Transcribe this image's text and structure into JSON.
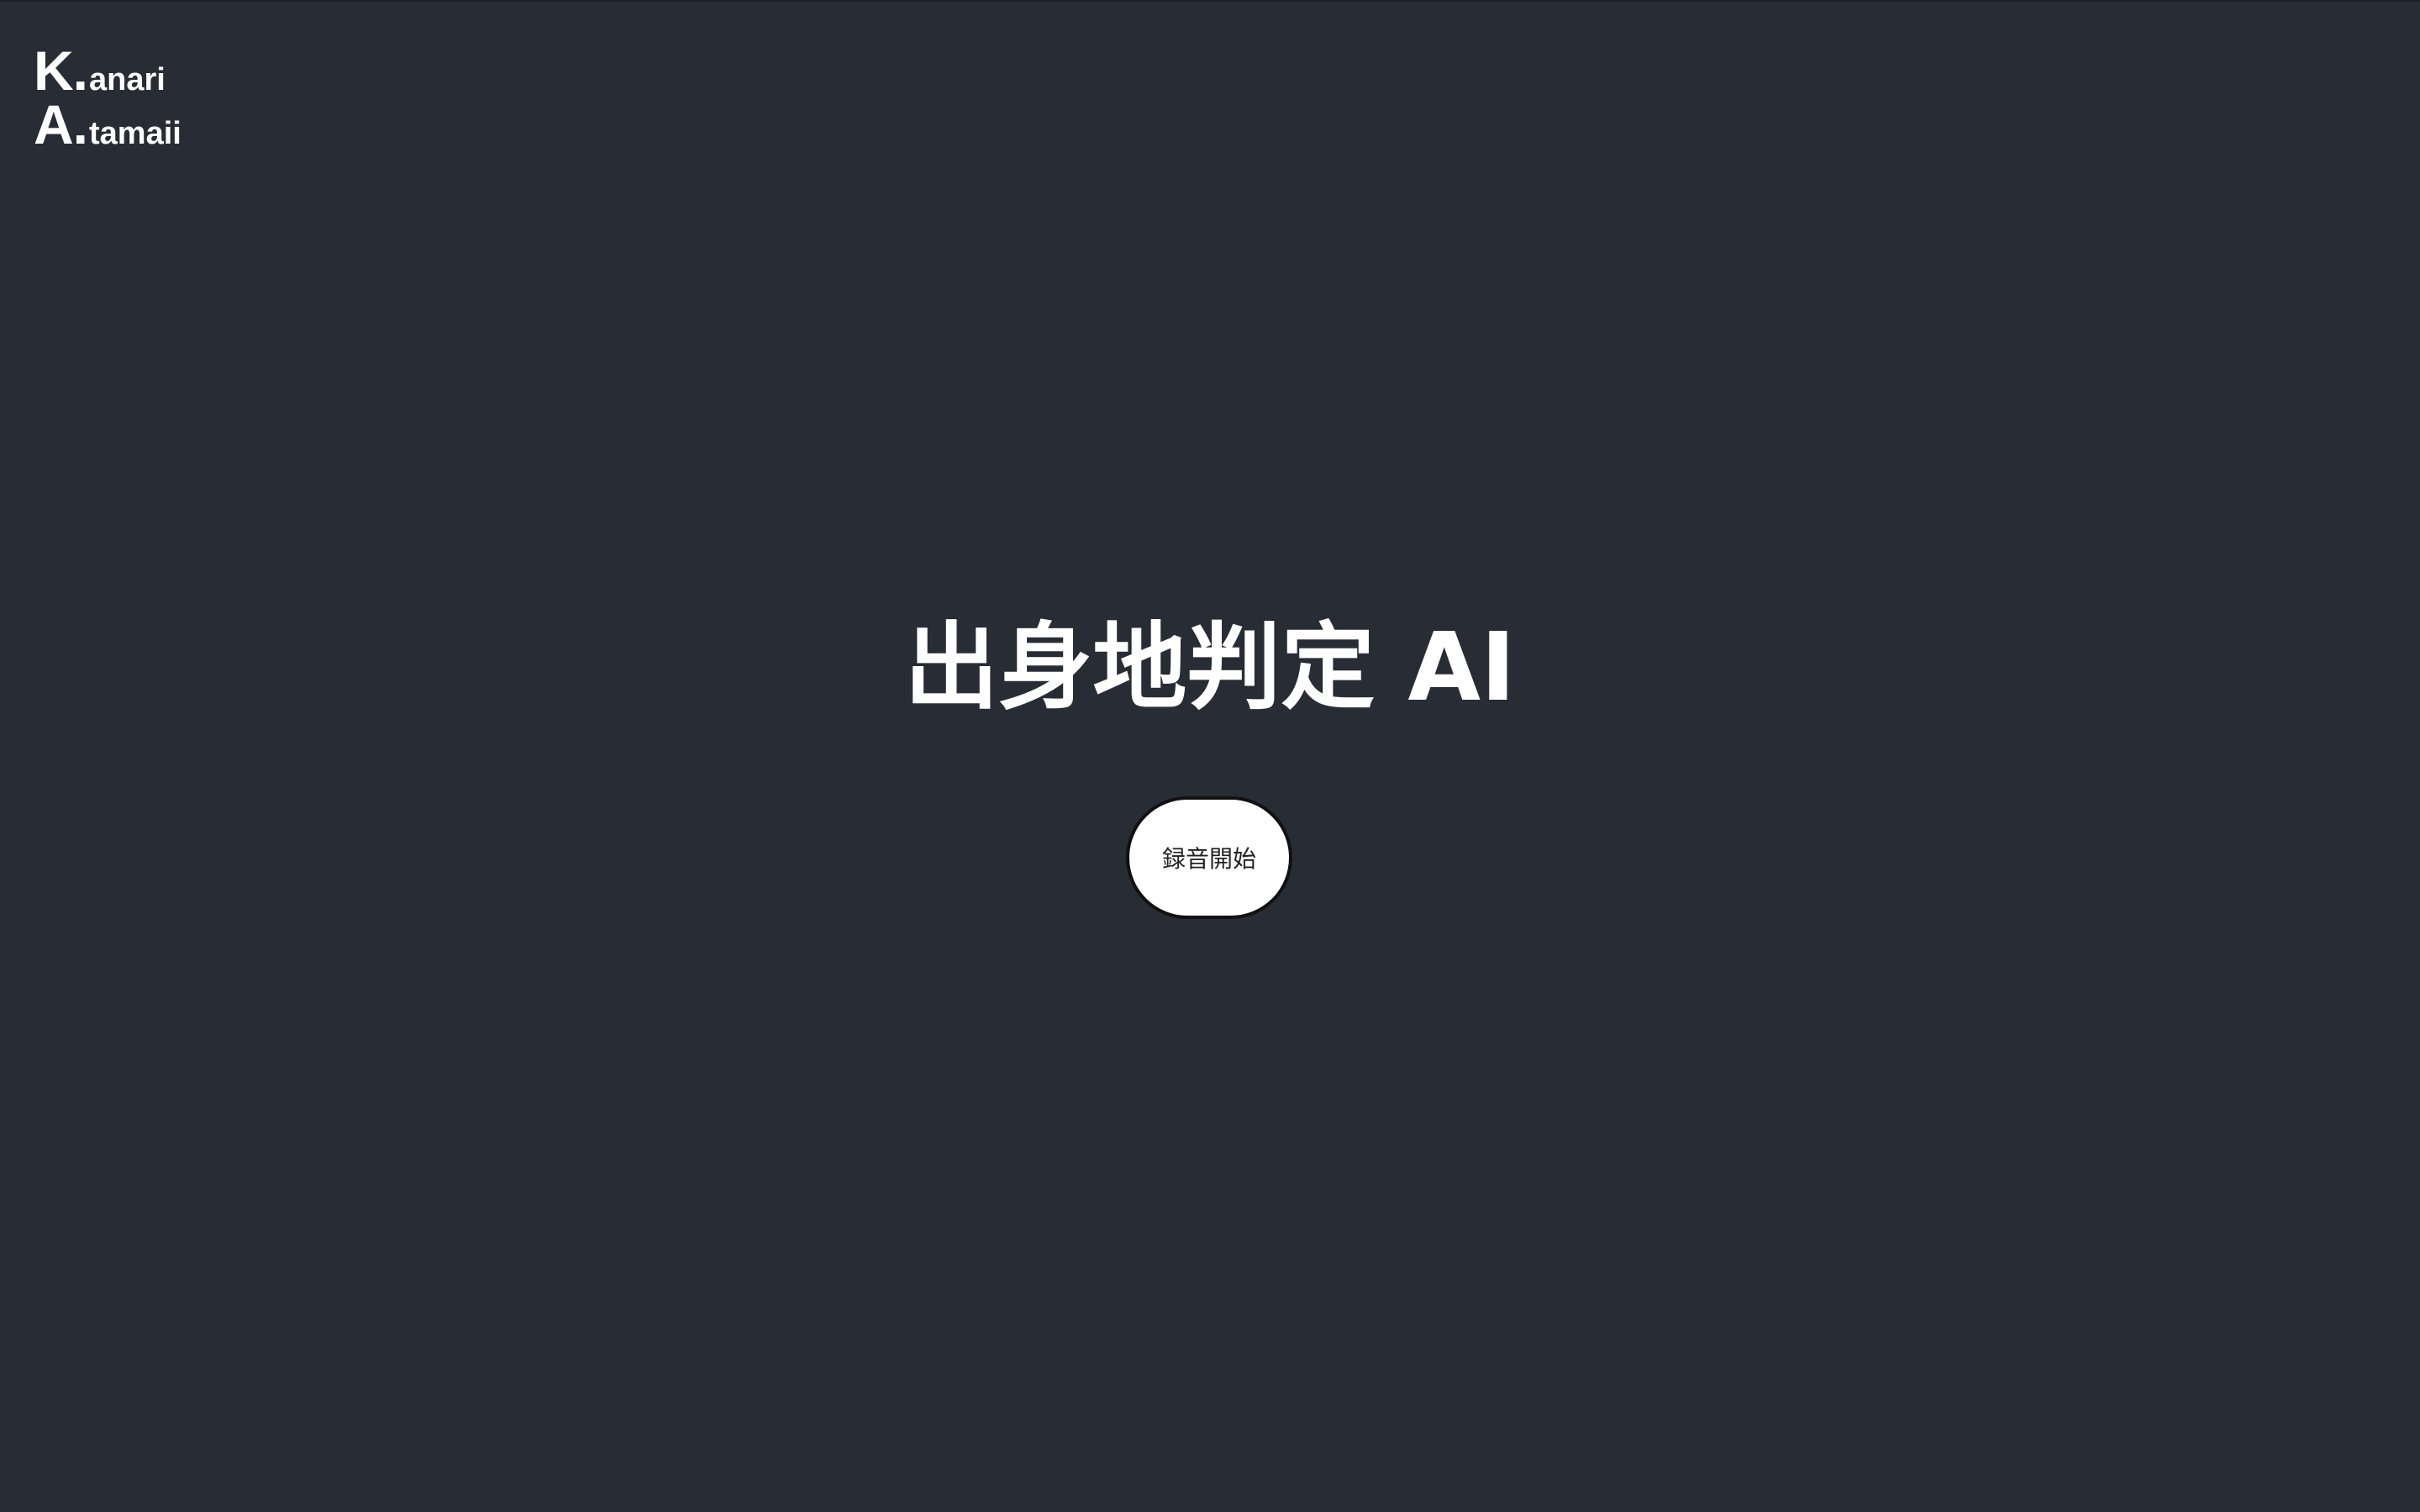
{
  "logo": {
    "line1_initial": "K.",
    "line1_rest": "anari",
    "line2_initial": "A.",
    "line2_rest": "tamaii"
  },
  "main": {
    "title": "出身地判定 AI",
    "record_button_label": "録音開始"
  },
  "colors": {
    "background": "#282c35",
    "text": "#ffffff",
    "button_bg": "#ffffff",
    "button_border": "#111111"
  }
}
